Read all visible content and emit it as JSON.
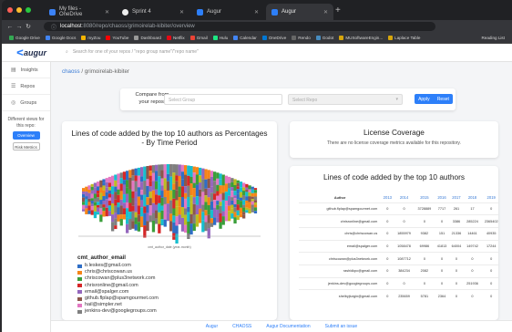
{
  "browser": {
    "tabs": [
      {
        "label": "My files - OneDrive",
        "icon": "onedrive-icon",
        "active": false
      },
      {
        "label": "Sprint 4",
        "icon": "github-icon",
        "active": false
      },
      {
        "label": "Augur",
        "icon": "augur-icon",
        "active": false
      },
      {
        "label": "Augur",
        "icon": "augur-icon",
        "active": true
      }
    ],
    "new_tab_label": "+",
    "url_host": "localhost",
    "url_path": ":8080/repo/chaoss/grimoirelab-kibiter/overview",
    "bookmarks": [
      "Google Drive",
      "Google Docs",
      "myZou",
      "YouTube",
      "Dashboard",
      "Netflix",
      "Gmail",
      "Hulu",
      "Calendar",
      "OneDrive",
      "Rendo",
      "Godot",
      "MUSoftwareEngin...",
      "Laplace Table"
    ],
    "reading_list": "Reading List"
  },
  "app": {
    "logo_text": "augur",
    "search_placeholder": "Search for one of your repos / \"repo group name\"/\"repo name\"",
    "sidebar": {
      "items": [
        {
          "label": "Insights",
          "icon": "chart-icon"
        },
        {
          "label": "Repos",
          "icon": "list-icon"
        },
        {
          "label": "Groups",
          "icon": "groups-icon"
        }
      ],
      "views_label": "Different views for this repo:",
      "overview_button": "Overview",
      "risk_button": "Risk Metrics"
    },
    "breadcrumb": {
      "group": "chaoss",
      "sep": "/",
      "repo": "grimoirelab-kibiter"
    },
    "compare": {
      "label": "Compare from your repos:",
      "group_placeholder": "Select Group",
      "repo_placeholder": "Select Repo",
      "apply": "Apply",
      "reset": "Reset"
    },
    "cards": {
      "loc_chart_title": "Lines of code added by the top 10 authors as Percentages - By Time Period",
      "x_axis_caption": "cmt_author_date (year-month)",
      "license_title": "License Coverage",
      "license_text": "There are no license coverage metrics available for this repository.",
      "loc_table_title": "Lines of code added by the top 10 authors"
    },
    "legend": {
      "title": "cmt_author_email",
      "entries": [
        {
          "label": "b.leskes@gmail.com",
          "color": "#2f6ec6"
        },
        {
          "label": "chris@chriscowan.us",
          "color": "#f58518"
        },
        {
          "label": "chriscowan@plus3network.com",
          "color": "#3a9e3a"
        },
        {
          "label": "chrisronline@gmail.com",
          "color": "#d62728"
        },
        {
          "label": "email@spalger.com",
          "color": "#9467bd"
        },
        {
          "label": "github.flplap@spamgourmet.com",
          "color": "#8c564b"
        },
        {
          "label": "hail@simpler.net",
          "color": "#e377c2"
        },
        {
          "label": "jenkins-dev@googlegroups.com",
          "color": "#7f7f7f"
        }
      ]
    },
    "loc_table": {
      "headers": [
        "Author",
        "2013",
        "2014",
        "2015",
        "2016",
        "2017",
        "2018",
        "2019",
        "2"
      ],
      "rows": [
        [
          "github.flplap@spamgourmet.com",
          "0",
          "0",
          "3728889",
          "7717",
          "261",
          "17",
          "0"
        ],
        [
          "chrisronline@gmail.com",
          "0",
          "0",
          "0",
          "0",
          "3386",
          "285224",
          "2365402"
        ],
        [
          "chris@chriscowan.us",
          "0",
          "1855979",
          "9382",
          "151",
          "21336",
          "14461",
          "40935"
        ],
        [
          "email@spalger.com",
          "0",
          "1058478",
          "69986",
          "41813",
          "64004",
          "149742",
          "17244"
        ],
        [
          "chriscowan@plus3network.com",
          "0",
          "1087712",
          "0",
          "0",
          "0",
          "0",
          "0"
        ],
        [
          "rashidkpc@gmail.com",
          "0",
          "384234",
          "2082",
          "0",
          "0",
          "0",
          "0"
        ],
        [
          "jenkins-dev@googlegroups.com",
          "0",
          "0",
          "0",
          "0",
          "0",
          "251936",
          "0"
        ],
        [
          "shelbyjturgin@gmail.com",
          "0",
          "235659",
          "5781",
          "2364",
          "0",
          "0",
          "0"
        ]
      ]
    },
    "footer": [
      "Augur",
      "CHAOSS",
      "Augur Documentation",
      "Submit an issue"
    ]
  }
}
